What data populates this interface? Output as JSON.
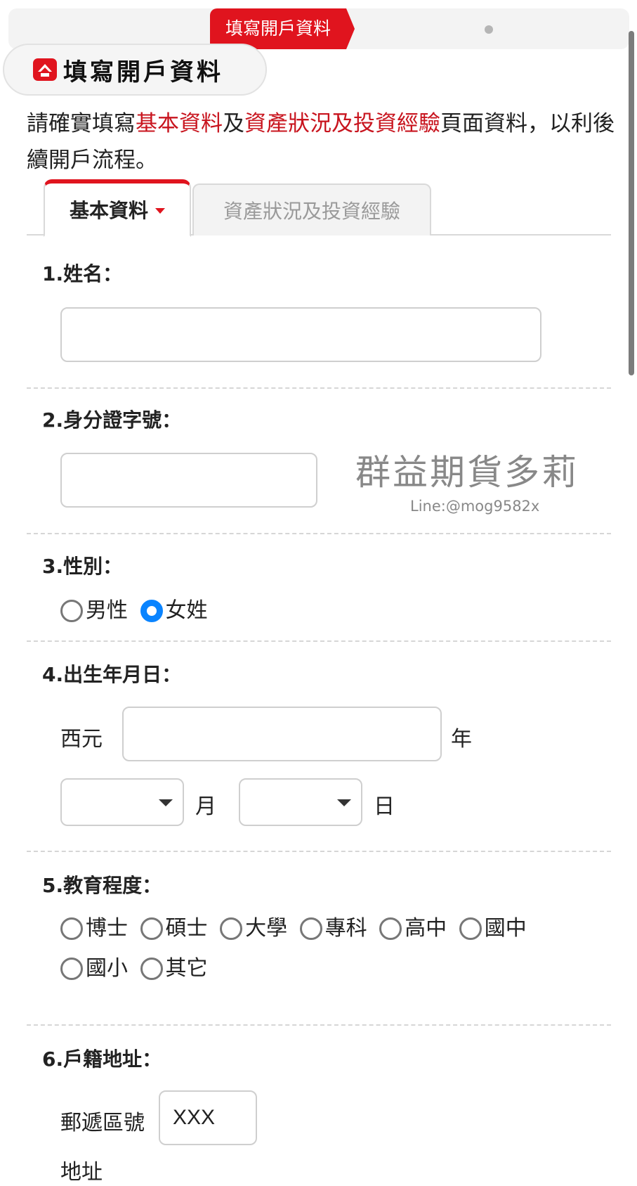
{
  "stepbar": {
    "active_step": "填寫開戶資料"
  },
  "title": "填寫開戶資料",
  "intro": {
    "part1": "請確實填寫",
    "red1": "基本資料",
    "part2": "及",
    "red2": "資產狀況及投資經驗",
    "part3": "頁面資料，以利後續開戶流程。"
  },
  "tabs": [
    {
      "label": "基本資料"
    },
    {
      "label": "資產狀況及投資經驗"
    }
  ],
  "fields": {
    "name": {
      "label": "1.姓名：",
      "value": ""
    },
    "id": {
      "label": "2.身分證字號：",
      "value": ""
    },
    "gender": {
      "label": "3.性別：",
      "options": [
        "男性",
        "女姓"
      ],
      "selected": "女姓"
    },
    "birth": {
      "label": "4.出生年月日：",
      "era": "西元",
      "year_suffix": "年",
      "month_suffix": "月",
      "day_suffix": "日",
      "year_value": "",
      "month_value": "",
      "day_value": ""
    },
    "education": {
      "label": "5.教育程度：",
      "options": [
        "博士",
        "碩士",
        "大學",
        "專科",
        "高中",
        "國中",
        "國小",
        "其它"
      ]
    },
    "address": {
      "label": "6.戶籍地址：",
      "zip_label": "郵遞區號",
      "zip_value": "XXX",
      "addr_label": "地址"
    }
  },
  "watermark": {
    "main": "群益期貨多莉",
    "sub": "Line:@mog9582x"
  },
  "colors": {
    "brand_red": "#e0141e",
    "text_red": "#c8141e",
    "radio_checked": "#0a84ff"
  },
  "icons": {
    "logo": "capital-logo-icon"
  }
}
